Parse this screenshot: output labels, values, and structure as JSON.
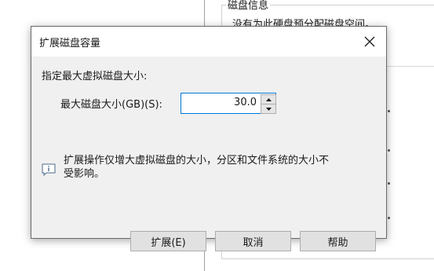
{
  "background": {
    "group_title": "磁盘信息",
    "line1": "没有为此硬盘预分配磁盘空间。"
  },
  "dialog": {
    "title": "扩展磁盘容量",
    "prompt": "指定最大虚拟磁盘大小:",
    "field_label": "最大磁盘大小(GB)(S):",
    "size_value": "30.0",
    "info_line1": "扩展操作仅增大虚拟磁盘的大小，分区和文件系统的大小不",
    "info_line2": "受影响。",
    "buttons": {
      "expand": "扩展(E)",
      "cancel": "取消",
      "help": "帮助"
    }
  },
  "icons": {
    "close": "close-icon",
    "info": "info-icon",
    "spin_up": "chevron-up-icon",
    "spin_down": "chevron-down-icon"
  }
}
